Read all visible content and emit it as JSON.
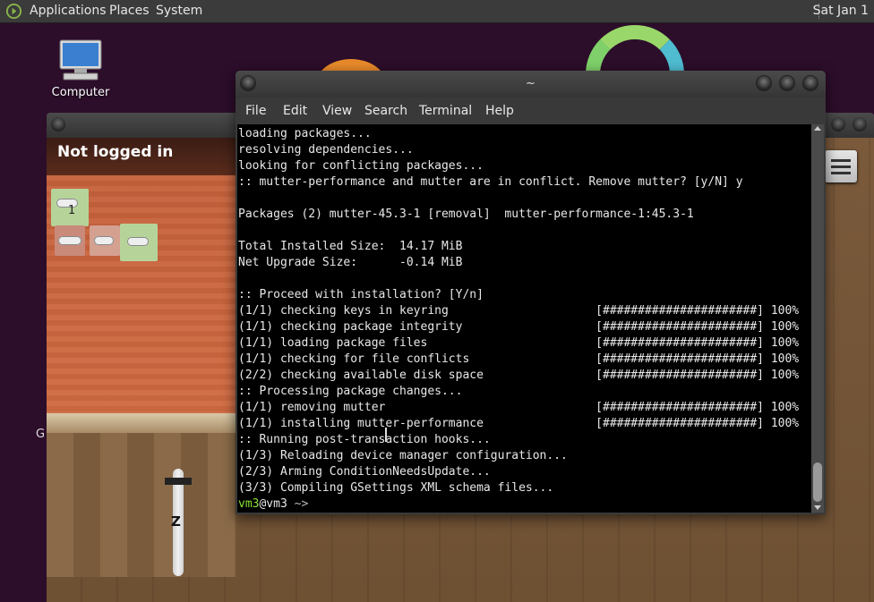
{
  "top_panel": {
    "menus": [
      "Applications",
      "Places",
      "System"
    ],
    "clock": "Sat Jan 1"
  },
  "desktop": {
    "computer_label": "Computer",
    "side_letter": "G"
  },
  "game": {
    "login_status": "Not logged in",
    "tile_number": "1",
    "zoom_label": "Z"
  },
  "terminal": {
    "title": "~",
    "menus": [
      "File",
      "Edit",
      "View",
      "Search",
      "Terminal",
      "Help"
    ],
    "lines": [
      "loading packages...",
      "resolving dependencies...",
      "looking for conflicting packages...",
      ":: mutter-performance and mutter are in conflict. Remove mutter? [y/N] y",
      "",
      "Packages (2) mutter-45.3-1 [removal]  mutter-performance-1:45.3-1",
      "",
      "Total Installed Size:  14.17 MiB",
      "Net Upgrade Size:      -0.14 MiB",
      "",
      ":: Proceed with installation? [Y/n]",
      "(1/1) checking keys in keyring                     [######################] 100%",
      "(1/1) checking package integrity                   [######################] 100%",
      "(1/1) loading package files                        [######################] 100%",
      "(1/1) checking for file conflicts                  [######################] 100%",
      "(2/2) checking available disk space                [######################] 100%",
      ":: Processing package changes...",
      "(1/1) removing mutter                              [######################] 100%",
      "(1/1) installing mutter-performance                [######################] 100%",
      ":: Running post-transaction hooks...",
      "(1/3) Reloading device manager configuration...",
      "(2/3) Arming ConditionNeedsUpdate...",
      "(3/3) Compiling GSettings XML schema files..."
    ],
    "prompt": {
      "user": "vm3",
      "host": "@vm3",
      "dir": " ~>"
    }
  },
  "colors": {
    "desktop_bg": "#2c0d2a",
    "prompt_user": "#8ae234"
  }
}
